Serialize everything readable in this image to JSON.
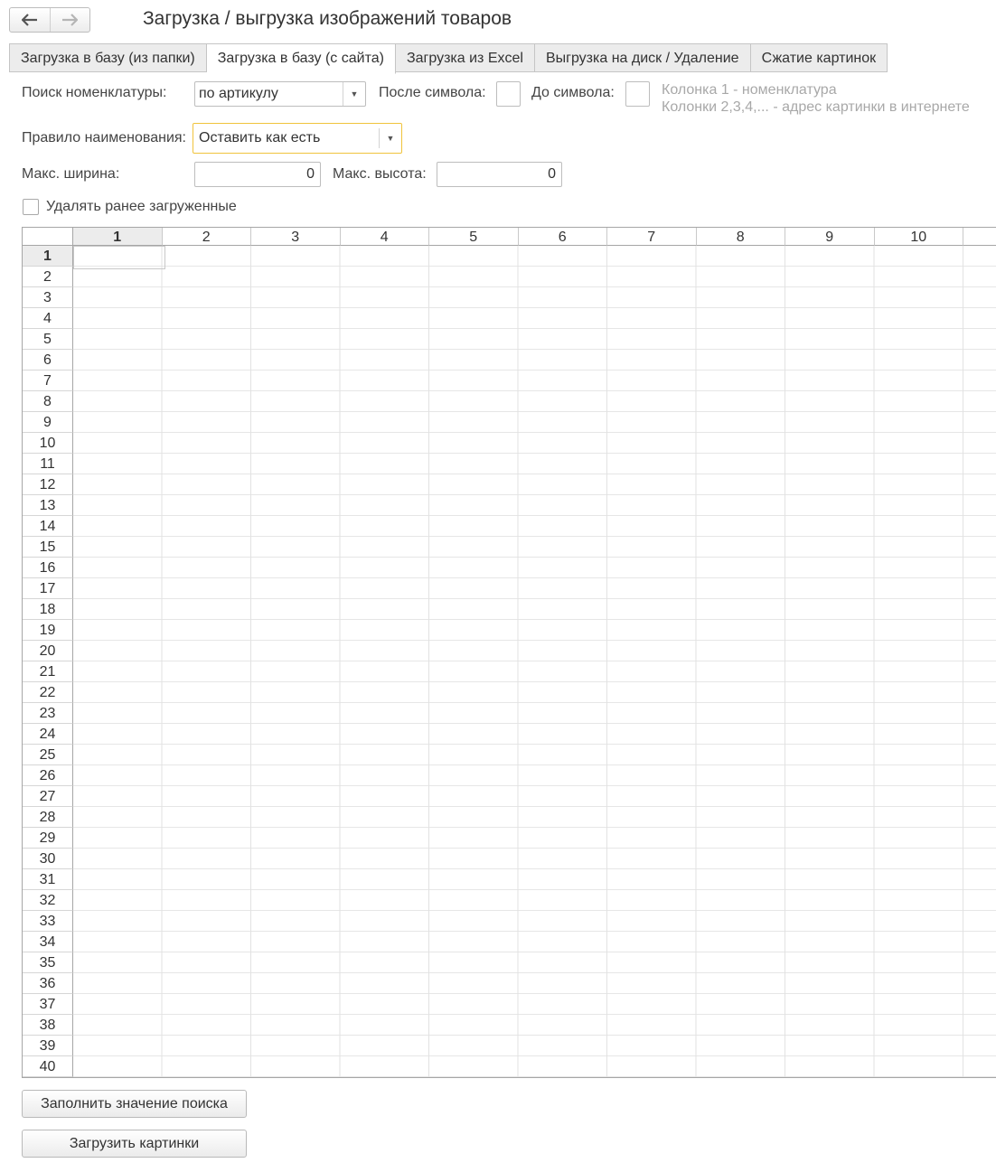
{
  "window": {
    "title": "Загрузка / выгрузка изображений товаров"
  },
  "nav": {
    "back_icon": "arrow-left-icon",
    "forward_icon": "arrow-right-icon"
  },
  "tabs": [
    {
      "label": "Загрузка в базу (из папки)",
      "active": false
    },
    {
      "label": "Загрузка в базу (с сайта)",
      "active": true
    },
    {
      "label": "Загрузка из Excel",
      "active": false
    },
    {
      "label": "Выгрузка на диск / Удаление",
      "active": false
    },
    {
      "label": "Сжатие картинок",
      "active": false
    }
  ],
  "form": {
    "search_label": "Поиск номенклатуры:",
    "search_value": "по артикулу",
    "after_symbol_label": "После символа:",
    "after_symbol_value": "",
    "before_symbol_label": "До символа:",
    "before_symbol_value": "",
    "hint_line1": "Колонка 1 - номенклатура",
    "hint_line2": "Колонки 2,3,4,... - адрес картинки в интернете",
    "naming_rule_label": "Правило наименования:",
    "naming_rule_value": "Оставить как есть",
    "max_width_label": "Макс. ширина:",
    "max_width_value": "0",
    "max_height_label": "Макс. высота:",
    "max_height_value": "0",
    "delete_previous_label": "Удалять ранее загруженные",
    "delete_previous_checked": false
  },
  "sheet": {
    "columns": [
      "1",
      "2",
      "3",
      "4",
      "5",
      "6",
      "7",
      "8",
      "9",
      "10"
    ],
    "rows": [
      "1",
      "2",
      "3",
      "4",
      "5",
      "6",
      "7",
      "8",
      "9",
      "10",
      "11",
      "12",
      "13",
      "14",
      "15",
      "16",
      "17",
      "18",
      "19",
      "20",
      "21",
      "22",
      "23",
      "24",
      "25",
      "26",
      "27",
      "28",
      "29",
      "30",
      "31",
      "32",
      "33",
      "34",
      "35",
      "36",
      "37",
      "38",
      "39",
      "40"
    ],
    "selected_column": "1",
    "selected_row": "1"
  },
  "buttons": {
    "fill_search": "Заполнить значение поиска",
    "load_images": "Загрузить картинки"
  },
  "colors": {
    "focus": "#f0c33c",
    "tab_inactive": "#ececec"
  }
}
